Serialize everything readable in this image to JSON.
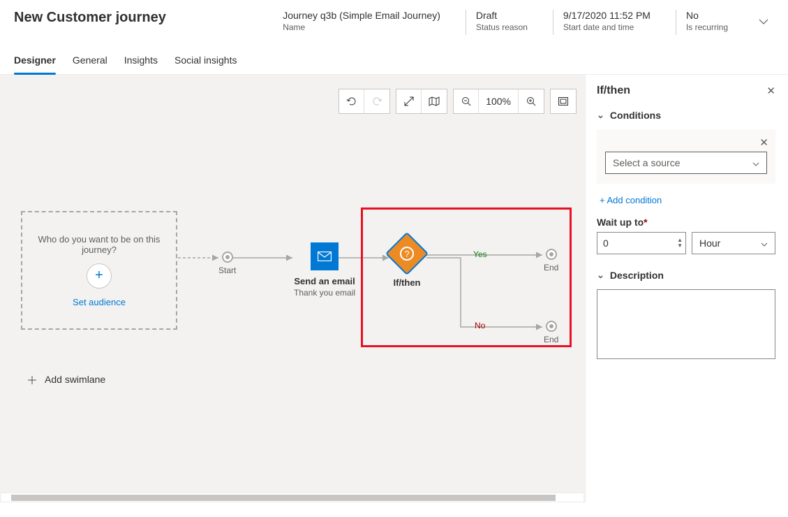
{
  "page_title": "New Customer journey",
  "meta": {
    "name": {
      "value": "Journey q3b (Simple Email Journey)",
      "label": "Name"
    },
    "status": {
      "value": "Draft",
      "label": "Status reason"
    },
    "start": {
      "value": "9/17/2020 11:52 PM",
      "label": "Start date and time"
    },
    "recurring": {
      "value": "No",
      "label": "Is recurring"
    }
  },
  "tabs": [
    "Designer",
    "General",
    "Insights",
    "Social insights"
  ],
  "toolbar": {
    "zoom": "100%"
  },
  "canvas": {
    "audience_prompt": "Who do you want to be on this journey?",
    "set_audience": "Set audience",
    "start": "Start",
    "email_title": "Send an email",
    "email_sub": "Thank you email",
    "ifthen": "If/then",
    "yes": "Yes",
    "no": "No",
    "end": "End",
    "add_swimlane": "Add swimlane"
  },
  "panel": {
    "title": "If/then",
    "conditions_heading": "Conditions",
    "select_source_placeholder": "Select a source",
    "add_condition": "+ Add condition",
    "wait_label": "Wait up to",
    "wait_value": "0",
    "wait_unit": "Hour",
    "description_heading": "Description"
  }
}
